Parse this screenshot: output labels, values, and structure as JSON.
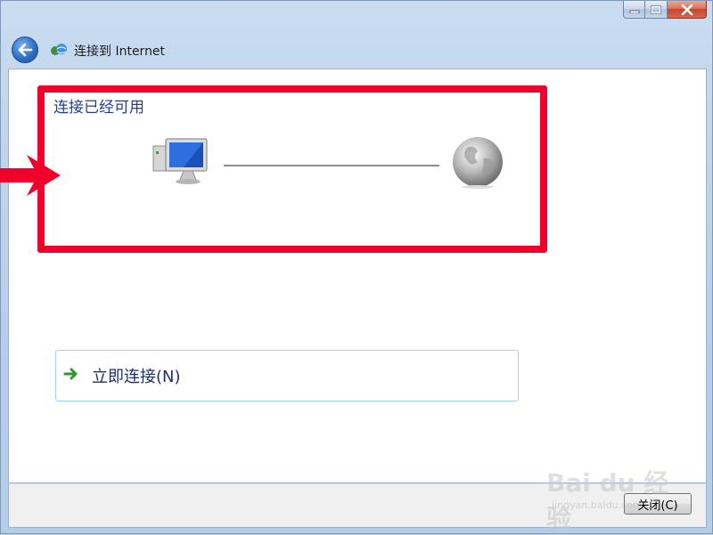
{
  "window": {
    "title": "连接到 Internet",
    "caption_min_icon": "minimize-icon",
    "caption_max_icon": "maximize-icon",
    "caption_close_icon": "close-icon"
  },
  "content": {
    "status": "连接已经可用",
    "connect_label": "立即连接(N)",
    "icons": [
      "computer-icon",
      "globe-icon",
      "arrow-right-icon"
    ]
  },
  "footer": {
    "close_label": "关闭(C)"
  },
  "annotation": {
    "highlight_color": "#f2002c"
  },
  "watermark": {
    "main": "Bai du 经验",
    "sub": "jingyan.baidu.com"
  }
}
